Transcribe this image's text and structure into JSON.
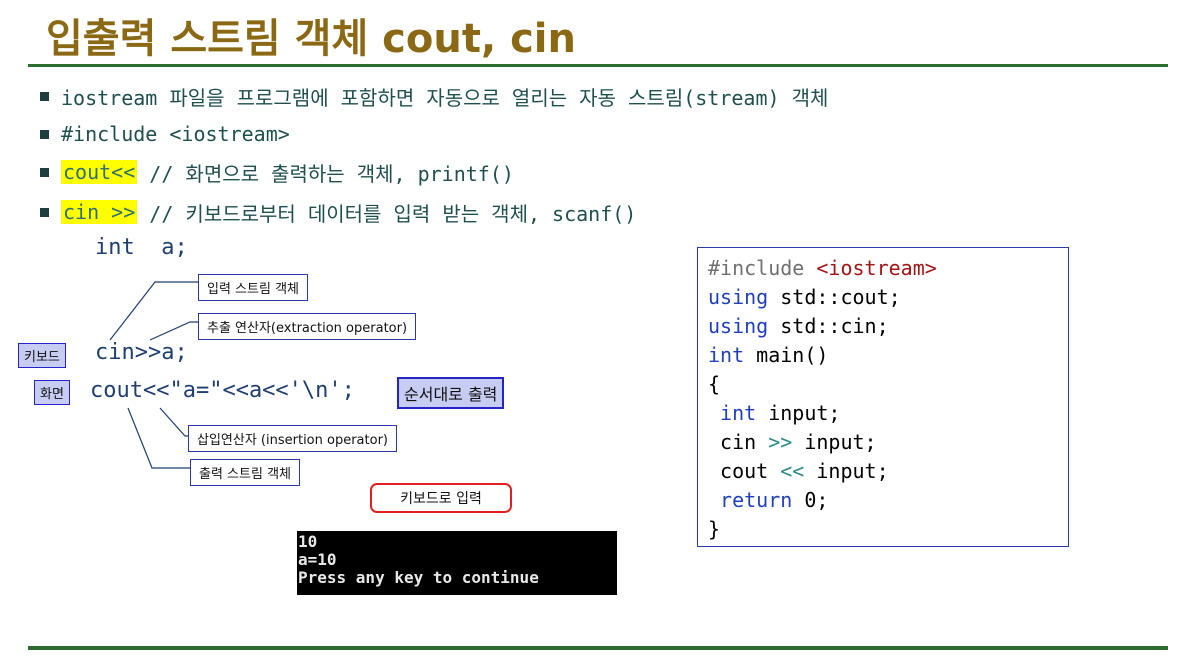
{
  "title": "입출력 스트림 객체 cout, cin",
  "bullets": [
    {
      "text": "iostream 파일을 프로그램에 포함하면 자동으로 열리는 자동 스트림(stream) 객체"
    },
    {
      "text": "#include <iostream>"
    },
    {
      "highlight": "cout<<",
      "text": " // 화면으로 출력하는 객체, printf()"
    },
    {
      "highlight": "cin >>",
      "text": " // 키보드로부터 데이터를 입력 받는 객체, scanf()"
    }
  ],
  "diagram": {
    "decl": "int  a;",
    "cin_line": "cin>>a;",
    "cout_line": "cout<<\"a=\"<<a<<'\\n';",
    "labels": {
      "input_stream": "입력 스트림 객체",
      "extraction": "추출 연산자(extraction operator)",
      "insertion": "삽입연산자 (insertion operator)",
      "output_stream": "출력 스트림 객체",
      "keyboard": "키보드",
      "screen": "화면",
      "in_order": "순서대로 출력",
      "keyboard_input": "키보드로 입력"
    }
  },
  "console": {
    "lines": [
      "10",
      "a=10",
      "Press any key to continue"
    ]
  },
  "code": {
    "include_directive": "#include",
    "include_header": "<iostream>",
    "using1_kw": "using",
    "using1_rest": " std::cout;",
    "using2_kw": "using",
    "using2_rest": " std::cin;",
    "main_kw": "int",
    "main_rest": " main()",
    "open_brace": "{",
    "decl_kw": "int",
    "decl_rest": " input;",
    "cin_a": " cin ",
    "cin_op": ">>",
    "cin_b": " input;",
    "cout_a": " cout ",
    "cout_op": "<<",
    "cout_b": " input;",
    "ret_kw": "return",
    "ret_rest": " 0;",
    "close_brace": "}"
  },
  "colors": {
    "title": "#8b6914",
    "rule": "#2e6b2e",
    "highlight": "#ffff00",
    "tag_fill": "#c7ccf2",
    "callout_border": "#e02020"
  }
}
